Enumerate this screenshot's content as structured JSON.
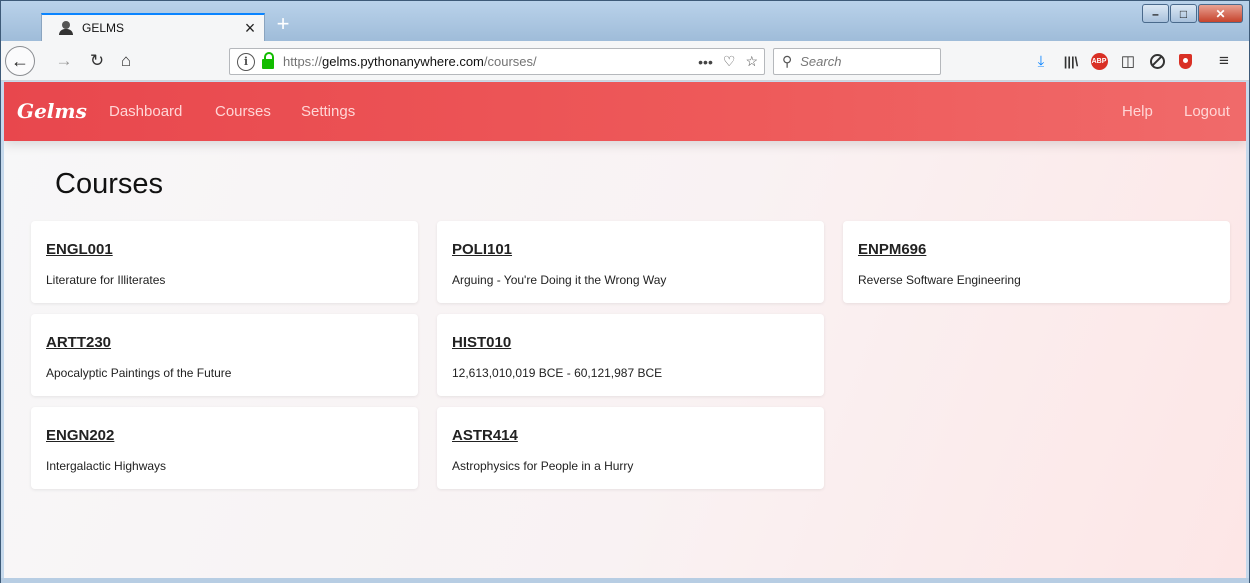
{
  "browser": {
    "tab_title": "GELMS",
    "tab_close": "×",
    "new_tab": "+",
    "url_protocol": "https://",
    "url_host": "gelms.pythonanywhere.com",
    "url_path": "/courses/",
    "search_placeholder": "Search",
    "window_buttons": {
      "minimize": "–",
      "maximize": "□",
      "close": "✕"
    }
  },
  "app": {
    "brand": "Gelms",
    "nav": {
      "dashboard": "Dashboard",
      "courses": "Courses",
      "settings": "Settings",
      "help": "Help",
      "logout": "Logout"
    },
    "page_title": "Courses",
    "courses": [
      {
        "code": "ENGL001",
        "name": "Literature for Illiterates"
      },
      {
        "code": "POLI101",
        "name": "Arguing - You're Doing it the Wrong Way"
      },
      {
        "code": "ENPM696",
        "name": "Reverse Software Engineering"
      },
      {
        "code": "ARTT230",
        "name": "Apocalyptic Paintings of the Future"
      },
      {
        "code": "HIST010",
        "name": "12,613,010,019 BCE - 60,121,987 BCE"
      },
      {
        "code": "ENGN202",
        "name": "Intergalactic Highways"
      },
      {
        "code": "ASTR414",
        "name": "Astrophysics for People in a Hurry"
      }
    ]
  }
}
